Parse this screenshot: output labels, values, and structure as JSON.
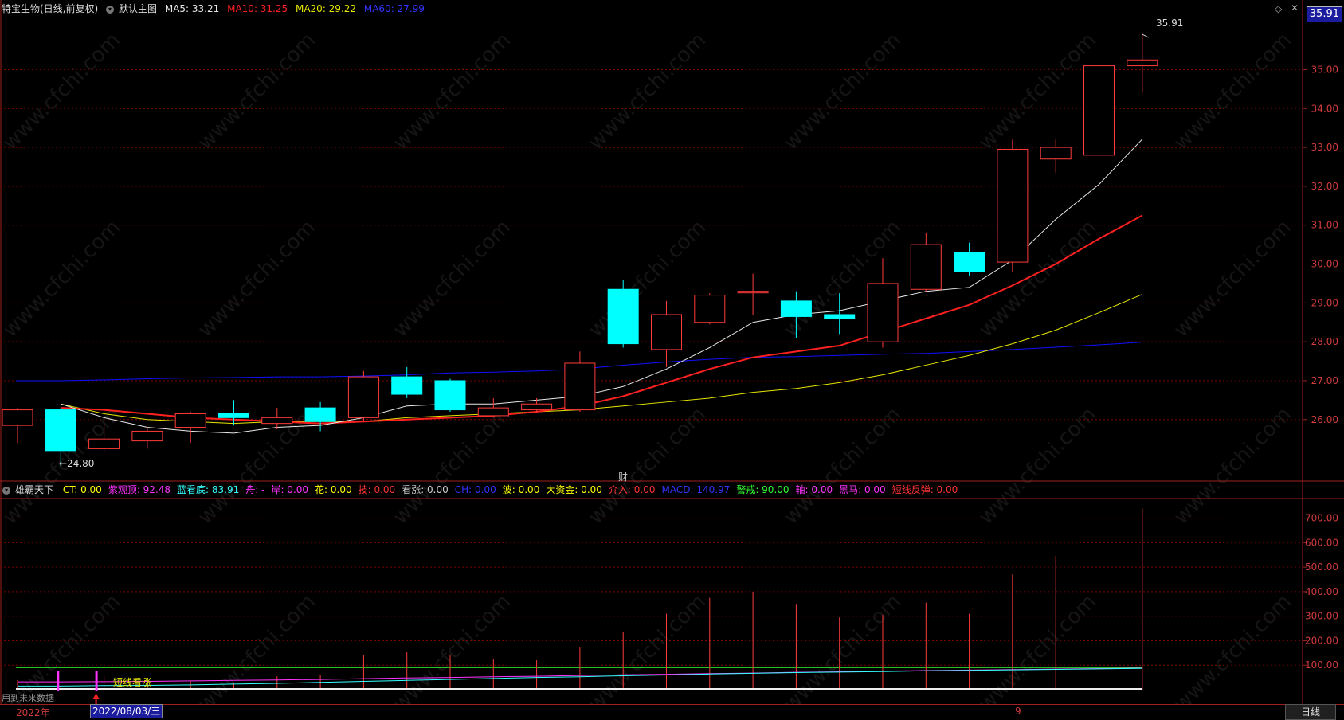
{
  "header": {
    "stock_title": "特宝生物(日线,前复权)",
    "chart_name": "默认主图",
    "ma5": "MA5: 33.21",
    "ma10": "MA10: 31.25",
    "ma20": "MA20: 29.22",
    "ma60": "MA60: 27.99",
    "last_price": "35.91"
  },
  "indicator": {
    "name": "雄霸天下",
    "items": [
      {
        "text": "CT: 0.00",
        "color": "#ffff00"
      },
      {
        "text": "紫观顶: 92.48",
        "color": "#ff33ff"
      },
      {
        "text": "蓝看底: 83.91",
        "color": "#33ffff"
      },
      {
        "text": "舟: -",
        "color": "#ff33ff"
      },
      {
        "text": "岸: 0.00",
        "color": "#ff33ff"
      },
      {
        "text": "花: 0.00",
        "color": "#ffff00"
      },
      {
        "text": "技: 0.00",
        "color": "#ff3333"
      },
      {
        "text": "看涨: 0.00",
        "color": "#cccccc"
      },
      {
        "text": "CH: 0.00",
        "color": "#3333ff"
      },
      {
        "text": "波: 0.00",
        "color": "#ffff00"
      },
      {
        "text": "大资金: 0.00",
        "color": "#ffff00"
      },
      {
        "text": "介入: 0.00",
        "color": "#ff3333"
      },
      {
        "text": "MACD: 140.97",
        "color": "#3333ff"
      },
      {
        "text": "警戒: 90.00",
        "color": "#33ff33"
      },
      {
        "text": "轴: 0.00",
        "color": "#ff33ff"
      },
      {
        "text": "黑马: 0.00",
        "color": "#ff33ff"
      },
      {
        "text": "短线反弹: 0.00",
        "color": "#ff3333"
      }
    ]
  },
  "annotations": {
    "high_label": "35.91",
    "low_label": "←24.80",
    "fin_marker": "财",
    "signal_label": "短线看涨",
    "future_data": "用到未来数据",
    "year_label": "2022年",
    "cursor_date": "2022/08/03/三",
    "month_label": "9",
    "period_tab": "日线"
  },
  "watermark": "www.cfchi.com",
  "colors": {
    "up": "#ff3b3b",
    "down": "#00ffff",
    "ma5": "#e8e8e8",
    "ma10": "#ff2020",
    "ma20": "#e6e600",
    "ma60": "#1010ff",
    "grid": "#7a0000"
  },
  "chart_data": [
    {
      "type": "candlestick",
      "ylim": [
        24.5,
        36.3
      ],
      "y_ticks": [
        26.0,
        27.0,
        28.0,
        29.0,
        30.0,
        31.0,
        32.0,
        33.0,
        34.0,
        35.0
      ],
      "candles": [
        {
          "o": 25.85,
          "h": 26.3,
          "l": 25.4,
          "c": 26.25
        },
        {
          "o": 26.25,
          "h": 26.3,
          "l": 24.8,
          "c": 25.2
        },
        {
          "o": 25.25,
          "h": 25.9,
          "l": 25.15,
          "c": 25.5
        },
        {
          "o": 25.45,
          "h": 25.8,
          "l": 25.25,
          "c": 25.7
        },
        {
          "o": 25.8,
          "h": 26.2,
          "l": 25.4,
          "c": 26.15
        },
        {
          "o": 26.15,
          "h": 26.5,
          "l": 25.85,
          "c": 26.05
        },
        {
          "o": 25.9,
          "h": 26.3,
          "l": 25.75,
          "c": 26.05
        },
        {
          "o": 26.3,
          "h": 26.45,
          "l": 25.7,
          "c": 25.95
        },
        {
          "o": 26.05,
          "h": 27.25,
          "l": 25.95,
          "c": 27.1
        },
        {
          "o": 27.1,
          "h": 27.35,
          "l": 26.55,
          "c": 26.65
        },
        {
          "o": 27.0,
          "h": 27.05,
          "l": 26.2,
          "c": 26.25
        },
        {
          "o": 26.1,
          "h": 26.55,
          "l": 26.05,
          "c": 26.3
        },
        {
          "o": 26.25,
          "h": 26.55,
          "l": 26.2,
          "c": 26.4
        },
        {
          "o": 26.25,
          "h": 27.75,
          "l": 26.2,
          "c": 27.45
        },
        {
          "o": 29.35,
          "h": 29.6,
          "l": 27.85,
          "c": 27.95
        },
        {
          "o": 27.8,
          "h": 29.05,
          "l": 27.35,
          "c": 28.7
        },
        {
          "o": 28.5,
          "h": 29.25,
          "l": 28.45,
          "c": 29.2
        },
        {
          "o": 29.3,
          "h": 29.75,
          "l": 28.7,
          "c": 29.3
        },
        {
          "o": 29.05,
          "h": 29.3,
          "l": 28.1,
          "c": 28.65
        },
        {
          "o": 28.7,
          "h": 29.25,
          "l": 28.2,
          "c": 28.6
        },
        {
          "o": 28.0,
          "h": 30.15,
          "l": 27.85,
          "c": 29.5
        },
        {
          "o": 29.35,
          "h": 30.8,
          "l": 29.3,
          "c": 30.5
        },
        {
          "o": 30.3,
          "h": 30.55,
          "l": 29.7,
          "c": 29.8
        },
        {
          "o": 30.05,
          "h": 33.2,
          "l": 29.8,
          "c": 32.95
        },
        {
          "o": 32.7,
          "h": 33.2,
          "l": 32.35,
          "c": 33.0
        },
        {
          "o": 32.8,
          "h": 35.7,
          "l": 32.6,
          "c": 35.1
        },
        {
          "o": 35.1,
          "h": 35.91,
          "l": 34.4,
          "c": 35.25
        }
      ],
      "ma5": [
        26.4,
        26.05,
        25.8,
        25.7,
        25.65,
        25.8,
        25.85,
        26.05,
        26.35,
        26.4,
        26.4,
        26.5,
        26.6,
        26.85,
        27.3,
        27.85,
        28.5,
        28.7,
        28.8,
        29.05,
        29.3,
        29.4,
        30.1,
        31.15,
        32.05,
        33.21
      ],
      "ma10": [
        26.3,
        26.25,
        26.15,
        26.05,
        26.0,
        25.95,
        25.9,
        25.95,
        26.0,
        26.05,
        26.1,
        26.2,
        26.35,
        26.6,
        26.95,
        27.3,
        27.6,
        27.75,
        27.9,
        28.25,
        28.6,
        28.95,
        29.45,
        30.0,
        30.65,
        31.25
      ],
      "ma20": [
        26.4,
        26.15,
        26.0,
        25.95,
        25.9,
        25.95,
        25.95,
        25.95,
        26.05,
        26.1,
        26.15,
        26.2,
        26.25,
        26.35,
        26.45,
        26.55,
        26.7,
        26.8,
        26.95,
        27.15,
        27.4,
        27.65,
        27.95,
        28.3,
        28.75,
        29.22
      ],
      "ma60": [
        27.0,
        27.02,
        27.05,
        27.07,
        27.08,
        27.1,
        27.1,
        27.12,
        27.15,
        27.2,
        27.22,
        27.25,
        27.3,
        27.4,
        27.48,
        27.55,
        27.6,
        27.62,
        27.65,
        27.68,
        27.7,
        27.75,
        27.8,
        27.86,
        27.92,
        27.99
      ]
    },
    {
      "type": "bar",
      "name": "雄霸天下",
      "ylim": [
        0,
        780
      ],
      "y_ticks": [
        100,
        200,
        300,
        400,
        500,
        600,
        700
      ],
      "values": [
        40,
        20,
        55,
        25,
        35,
        30,
        55,
        60,
        140,
        155,
        140,
        125,
        120,
        175,
        235,
        310,
        375,
        400,
        350,
        295,
        305,
        355,
        310,
        470,
        545,
        685,
        740
      ],
      "line_purple": [
        32,
        32,
        33,
        34,
        36,
        38,
        40,
        42,
        45,
        48,
        50,
        53,
        55,
        58,
        61,
        63,
        66,
        68,
        71,
        73,
        76,
        78,
        80,
        82,
        84,
        86,
        88
      ],
      "line_cyan": [
        15,
        15,
        17,
        18,
        20,
        23,
        26,
        30,
        34,
        38,
        42,
        46,
        50,
        53,
        57,
        60,
        64,
        67,
        70,
        72,
        74,
        77,
        79,
        81,
        83,
        85,
        87
      ],
      "alert_level": 90
    }
  ]
}
